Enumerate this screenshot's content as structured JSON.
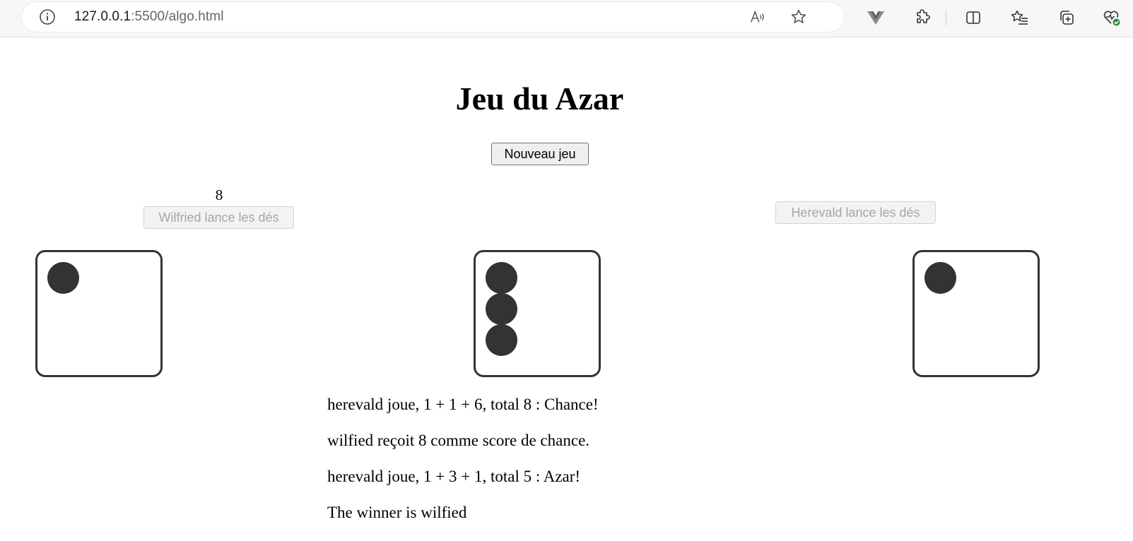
{
  "browser": {
    "url_host": "127.0.0.1",
    "url_path": ":5500/algo.html",
    "icons": [
      "info-icon",
      "read-aloud-icon",
      "favorite-star-icon",
      "vue-extension-icon",
      "extensions-icon",
      "split-screen-icon",
      "favorites-icon",
      "collections-icon",
      "browser-essentials-icon"
    ]
  },
  "game": {
    "title": "Jeu du Azar",
    "new_game_label": "Nouveau jeu",
    "player1": {
      "score": "8",
      "roll_button_label": "Wilfried lance les dés",
      "roll_button_enabled": false
    },
    "player2": {
      "roll_button_label": "Herevald lance les dés",
      "roll_button_enabled": false
    },
    "dice": [
      1,
      3,
      1
    ],
    "pip_color": "#333333",
    "log": [
      "herevald joue, 1 + 1 + 6, total 8 : Chance!",
      "wilfied reçoit 8 comme score de chance.",
      "herevald joue, 1 + 3 + 1, total 5 : Azar!",
      "The winner is wilfied"
    ]
  }
}
